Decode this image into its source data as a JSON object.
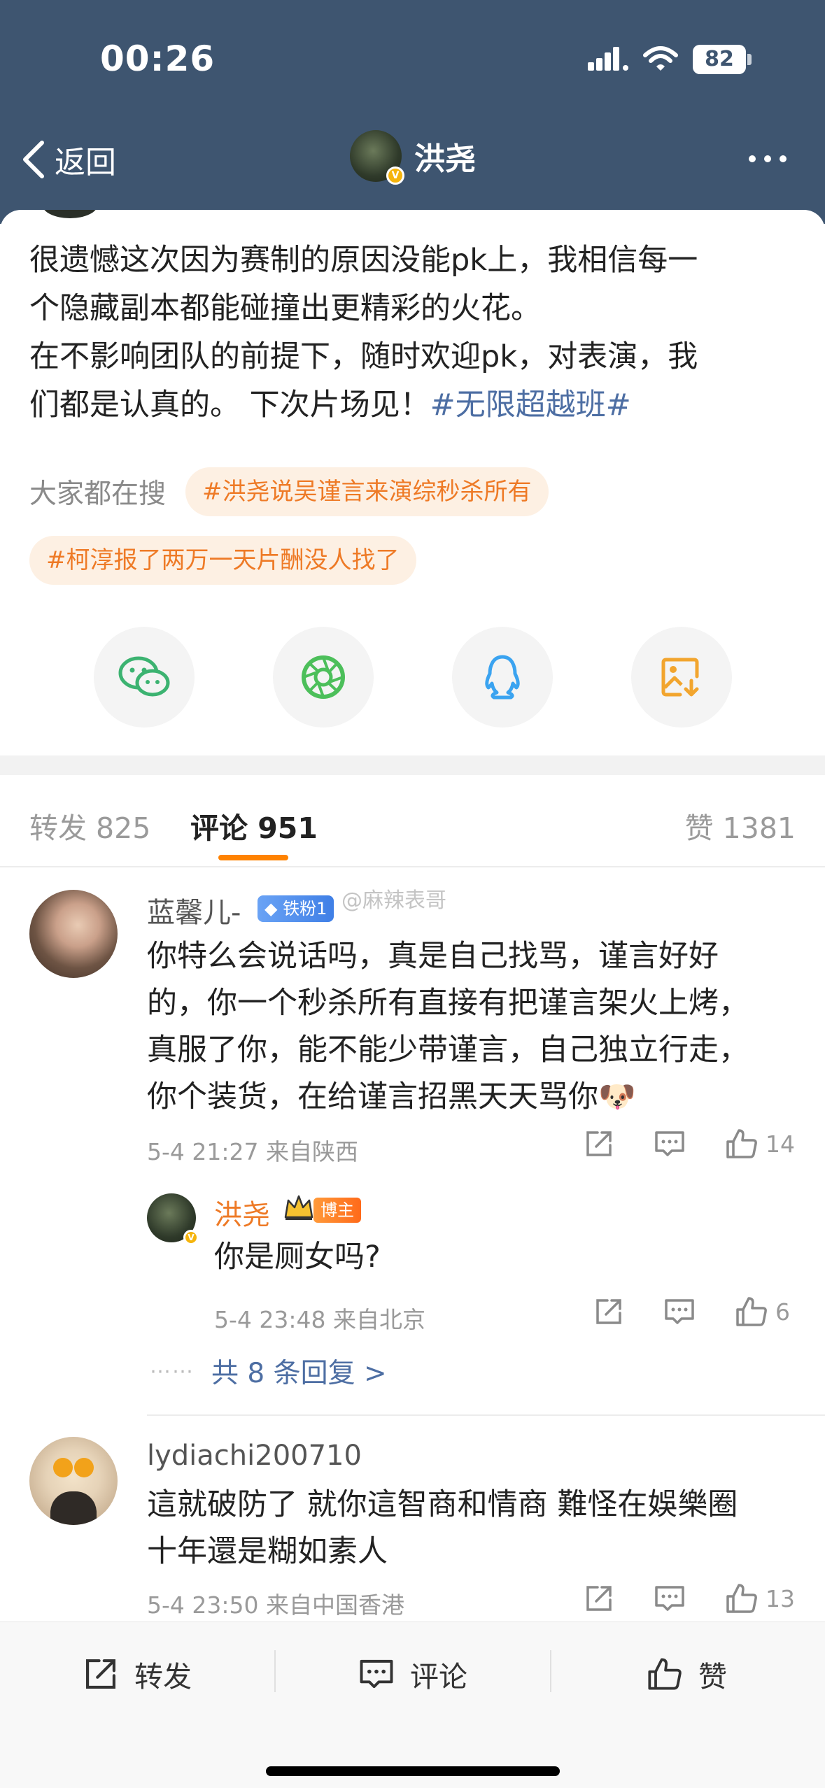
{
  "status_bar": {
    "time": "00:26",
    "battery": "82"
  },
  "nav": {
    "back_label": "返回",
    "title": "洪尧"
  },
  "post": {
    "lines": [
      "很遗憾这次因为赛制的原因没能pk上，我相信每一",
      "个隐藏副本都能碰撞出更精彩的火花。",
      "在不影响团队的前提下，随时欢迎pk，对表演，我",
      "们都是认真的。 下次片场见！"
    ],
    "hashtag": "#无限超越班#"
  },
  "trending": {
    "label": "大家都在搜",
    "chips": [
      "#洪尧说吴谨言来演综秒杀所有",
      "#柯淳报了两万一天片酬没人找了"
    ]
  },
  "share_icons": [
    "wechat-icon",
    "moments-icon",
    "qq-icon",
    "save-image-icon"
  ],
  "tabs": {
    "repost": "转发 825",
    "comment": "评论 951",
    "like": "赞 1381"
  },
  "watermark": "@麻辣表哥",
  "comments": [
    {
      "user": "蓝馨儿-",
      "badge": "铁粉1",
      "lines": [
        "你特么会说话吗，真是自己找骂，谨言好好",
        "的，你一个秒杀所有直接有把谨言架火上烤，",
        "真服了你，能不能少带谨言，自己独立行走，",
        "你个装货，在给谨言招黑天天骂你"
      ],
      "emoji": "🐶",
      "meta": "5-4 21:27  来自陕西",
      "likes": "14",
      "reply": {
        "user": "洪尧",
        "badge": "博主",
        "text": "你是厕女吗?",
        "meta": "5-4 23:48  来自北京",
        "likes": "6"
      },
      "more_replies": "共 8 条回复 >",
      "dots": "⋯⋯"
    },
    {
      "user": "lydiachi200710",
      "lines": [
        "這就破防了 就你這智商和情商 難怪在娛樂圈",
        "十年還是糊如素人"
      ],
      "meta": "5-4 23:50  来自中国香港",
      "likes": "13"
    }
  ],
  "bottom_bar": {
    "repost": "转发",
    "comment": "评论",
    "like": "赞"
  },
  "colors": {
    "header": "#3e5570",
    "accent": "#ff8200",
    "link": "#4d6ea3",
    "chip_text": "#ee7a26"
  }
}
